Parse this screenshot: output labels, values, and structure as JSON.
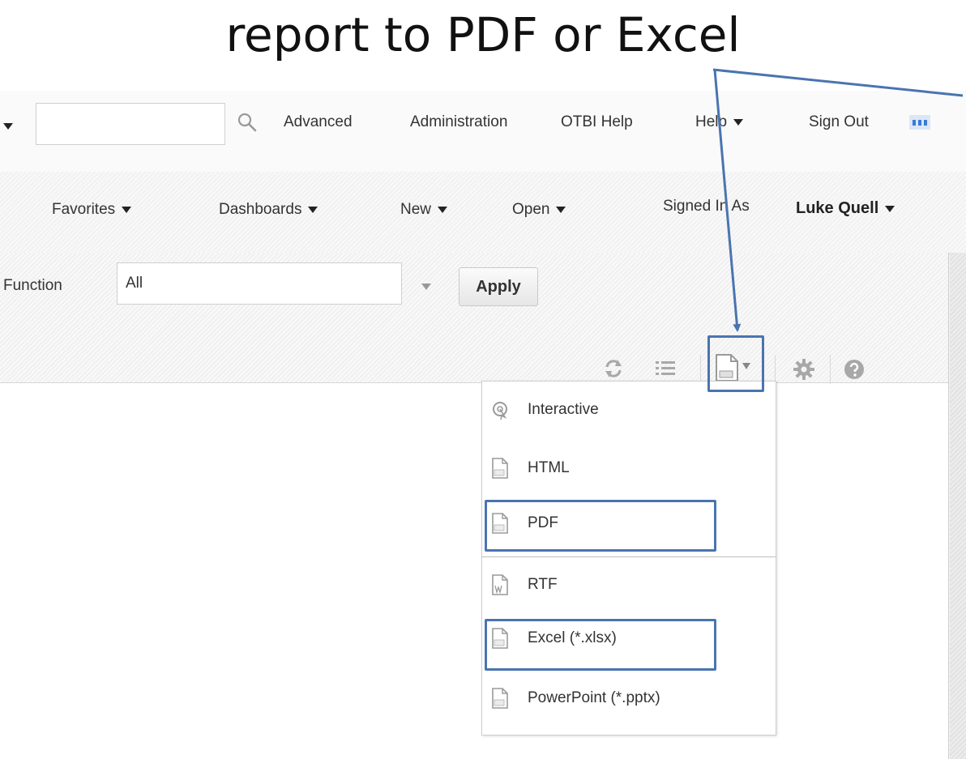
{
  "caption": "report to PDF or Excel",
  "global_bar": {
    "search_value": "",
    "advanced": "Advanced",
    "administration": "Administration",
    "otbi_help": "OTBI Help",
    "help": "Help",
    "sign_out": "Sign Out"
  },
  "nav_bar": {
    "favorites": "Favorites",
    "dashboards": "Dashboards",
    "new": "New",
    "open": "Open",
    "signed_in_as": "Signed In As",
    "user": "Luke Quell"
  },
  "filter": {
    "label": "Function",
    "value": "All",
    "apply": "Apply"
  },
  "export_menu": {
    "items": [
      {
        "label": "Interactive",
        "icon": "interactive-icon"
      },
      {
        "label": "HTML",
        "icon": "html-file-icon"
      },
      {
        "label": "PDF",
        "icon": "pdf-file-icon"
      },
      {
        "label": "RTF",
        "icon": "rtf-file-icon"
      },
      {
        "label": "Excel (*.xlsx)",
        "icon": "excel-file-icon"
      },
      {
        "label": "PowerPoint (*.pptx)",
        "icon": "powerpoint-file-icon"
      }
    ]
  },
  "colors": {
    "callout": "#4a74b0",
    "accent_blue": "#3a7bd5"
  }
}
